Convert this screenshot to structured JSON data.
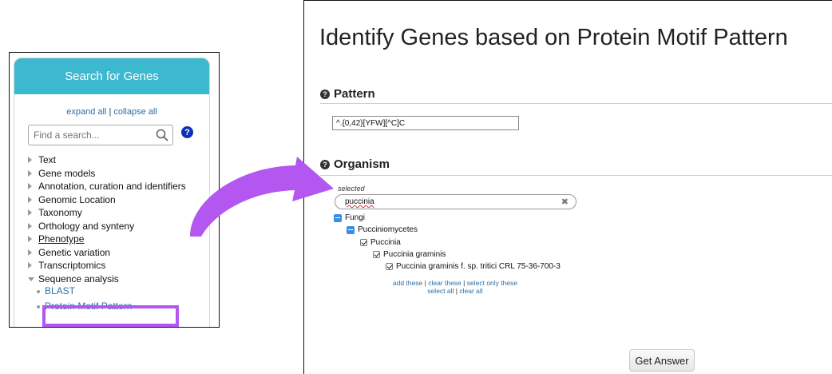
{
  "left_panel": {
    "header": "Search for Genes",
    "expand_all": "expand all",
    "separator": "|",
    "collapse_all": "collapse all",
    "find_placeholder": "Find a search...",
    "categories": [
      {
        "label": "Text"
      },
      {
        "label": "Gene models"
      },
      {
        "label": "Annotation, curation and identifiers"
      },
      {
        "label": "Genomic Location"
      },
      {
        "label": "Taxonomy"
      },
      {
        "label": "Orthology and synteny"
      },
      {
        "label": "Phenotype"
      },
      {
        "label": "Genetic variation"
      },
      {
        "label": "Transcriptomics"
      },
      {
        "label": "Sequence analysis"
      }
    ],
    "sequence_items": [
      {
        "label": "BLAST"
      },
      {
        "label": "Protein Motif Pattern"
      }
    ],
    "highlight_color": "#b357f0",
    "header_color": "#3cb8cf"
  },
  "right_panel": {
    "title": "Identify Genes based on Protein Motif Pattern",
    "pattern_label": "Pattern",
    "pattern_value": "^.{0,42}[YFW][^C]C",
    "organism_label": "Organism",
    "selected_label": "selected",
    "organism_search_value": "puccinia",
    "tree": {
      "fungi": "Fungi",
      "pucciniomycetes": "Pucciniomycetes",
      "puccinia": "Puccinia",
      "puccinia_graminis": "Puccinia graminis",
      "strain": "Puccinia graminis f. sp. tritici CRL 75-36-700-3"
    },
    "links": {
      "add_these": "add these",
      "clear_these": "clear these",
      "select_only_these": "select only these",
      "select_all": "select all",
      "clear_all": "clear all",
      "sep": "|"
    },
    "get_answer": "Get Answer"
  },
  "arrow_color": "#b357f0"
}
